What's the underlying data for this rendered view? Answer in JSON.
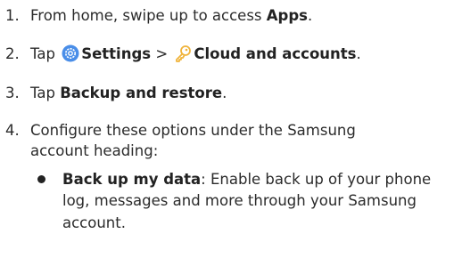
{
  "steps": [
    {
      "num": "1.",
      "pre": "From home, swipe up to access ",
      "bold": "Apps",
      "post": "."
    },
    {
      "num": "2.",
      "pre": "Tap ",
      "settings": "Settings",
      "sep": " > ",
      "cloud": "Cloud and accounts",
      "post": "."
    },
    {
      "num": "3.",
      "pre": "Tap ",
      "bold": "Backup and restore",
      "post": "."
    },
    {
      "num": "4.",
      "line1": "Configure these options under the Samsung",
      "line2": "account heading:"
    }
  ],
  "bullet": {
    "bold": "Back up my data",
    "line1_rest": ": Enable back up of your phone",
    "line2": "log, messages and more through your Samsung",
    "line3": "account."
  },
  "icons": {
    "settings": "settings-gear-icon",
    "cloud": "key-icon"
  },
  "colors": {
    "settings_icon": "#4a8ee8",
    "cloud_icon": "#f0b43c",
    "text": "#2b2b2b"
  }
}
